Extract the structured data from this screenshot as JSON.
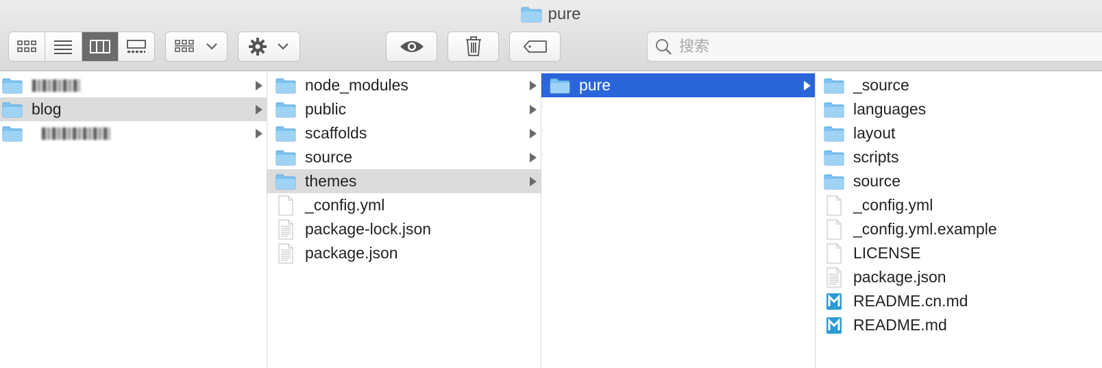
{
  "window": {
    "title": "pure"
  },
  "toolbar": {
    "view_buttons": [
      "icon-view-icon",
      "list-view-icon",
      "column-view-icon",
      "gallery-view-icon"
    ],
    "active_view": "column",
    "search_placeholder": "搜索"
  },
  "columns": [
    {
      "items": [
        {
          "name": "",
          "type": "folder",
          "arrow": true,
          "selected": "",
          "redacted": true
        },
        {
          "name": "blog",
          "type": "folder",
          "arrow": true,
          "selected": "gray"
        },
        {
          "name": "",
          "type": "folder",
          "arrow": true,
          "selected": "",
          "redacted": true
        }
      ]
    },
    {
      "items": [
        {
          "name": "node_modules",
          "type": "folder",
          "arrow": true,
          "selected": ""
        },
        {
          "name": "public",
          "type": "folder",
          "arrow": true,
          "selected": ""
        },
        {
          "name": "scaffolds",
          "type": "folder",
          "arrow": true,
          "selected": ""
        },
        {
          "name": "source",
          "type": "folder",
          "arrow": true,
          "selected": ""
        },
        {
          "name": "themes",
          "type": "folder",
          "arrow": true,
          "selected": "gray"
        },
        {
          "name": "_config.yml",
          "type": "file",
          "arrow": false,
          "selected": ""
        },
        {
          "name": "package-lock.json",
          "type": "textfile",
          "arrow": false,
          "selected": ""
        },
        {
          "name": "package.json",
          "type": "textfile",
          "arrow": false,
          "selected": ""
        }
      ]
    },
    {
      "items": [
        {
          "name": "pure",
          "type": "folder",
          "arrow": true,
          "selected": "blue"
        }
      ]
    },
    {
      "items": [
        {
          "name": "_source",
          "type": "folder",
          "arrow": false,
          "selected": ""
        },
        {
          "name": "languages",
          "type": "folder",
          "arrow": false,
          "selected": ""
        },
        {
          "name": "layout",
          "type": "folder",
          "arrow": false,
          "selected": ""
        },
        {
          "name": "scripts",
          "type": "folder",
          "arrow": false,
          "selected": ""
        },
        {
          "name": "source",
          "type": "folder",
          "arrow": false,
          "selected": ""
        },
        {
          "name": "_config.yml",
          "type": "file",
          "arrow": false,
          "selected": ""
        },
        {
          "name": "_config.yml.example",
          "type": "file",
          "arrow": false,
          "selected": ""
        },
        {
          "name": "LICENSE",
          "type": "file",
          "arrow": false,
          "selected": ""
        },
        {
          "name": "package.json",
          "type": "textfile",
          "arrow": false,
          "selected": ""
        },
        {
          "name": "README.cn.md",
          "type": "markdown",
          "arrow": false,
          "selected": ""
        },
        {
          "name": "README.md",
          "type": "markdown",
          "arrow": false,
          "selected": ""
        }
      ]
    }
  ],
  "colors": {
    "selection_blue": "#2a66d9",
    "selection_gray": "#dcdcdc",
    "folder": "#7cc2f2"
  }
}
